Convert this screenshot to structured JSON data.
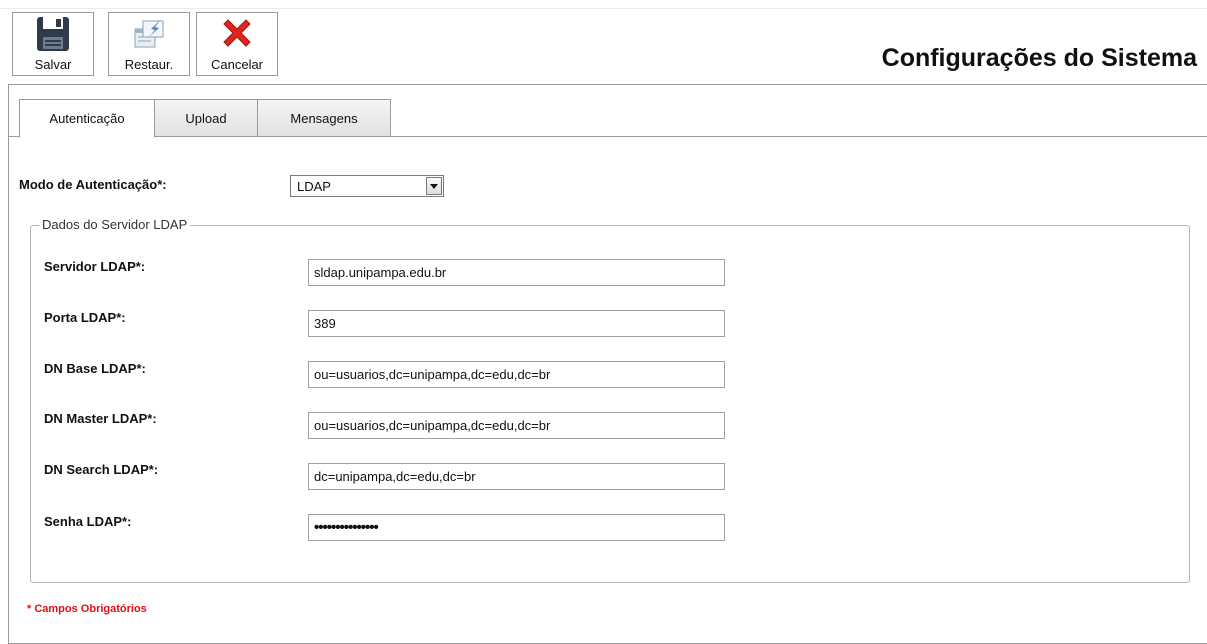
{
  "toolbar": {
    "save_label": "Salvar",
    "restore_label": "Restaur.",
    "cancel_label": "Cancelar"
  },
  "page_title": "Configurações do Sistema",
  "tabs": [
    {
      "label": "Autenticação",
      "active": true
    },
    {
      "label": "Upload",
      "active": false
    },
    {
      "label": "Mensagens",
      "active": false
    }
  ],
  "auth_mode": {
    "label": "Modo de Autenticação*:",
    "selected": "LDAP"
  },
  "ldap": {
    "legend": "Dados do Servidor LDAP",
    "fields": [
      {
        "label": "Servidor LDAP*:",
        "value": "sldap.unipampa.edu.br"
      },
      {
        "label": "Porta LDAP*:",
        "value": "389"
      },
      {
        "label": "DN Base LDAP*:",
        "value": "ou=usuarios,dc=unipampa,dc=edu,dc=br"
      },
      {
        "label": "DN Master LDAP*:",
        "value": "ou=usuarios,dc=unipampa,dc=edu,dc=br"
      },
      {
        "label": "DN Search LDAP*:",
        "value": "dc=unipampa,dc=edu,dc=br"
      },
      {
        "label": "Senha LDAP*:",
        "value": "•••••••••••••••"
      }
    ]
  },
  "required_note": "* Campos Obrigatórios",
  "icons": {
    "save": "floppy-disk-icon",
    "restore": "restore-icon",
    "cancel": "red-x-icon"
  },
  "colors": {
    "required": "#e01010",
    "cancel_icon": "#e0261c"
  }
}
